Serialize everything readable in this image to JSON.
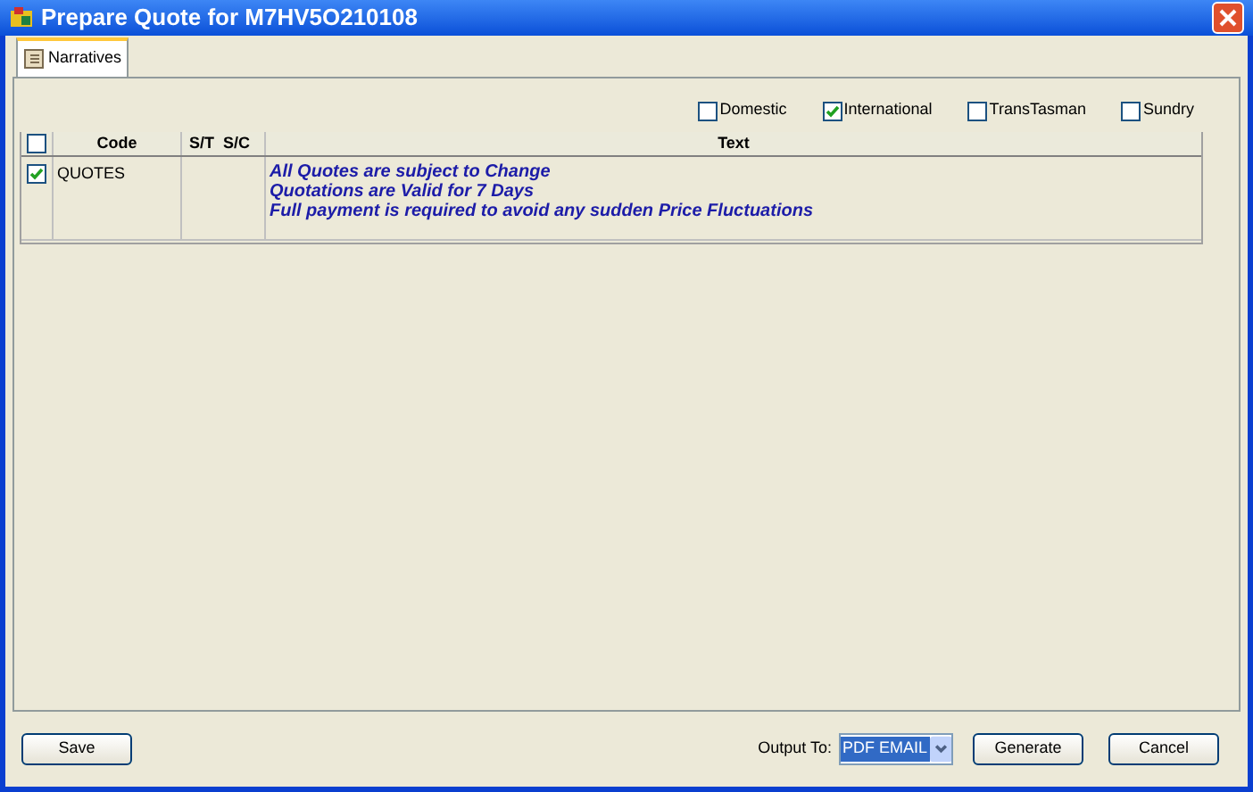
{
  "window": {
    "title": "Prepare Quote for M7HV5O210108"
  },
  "tabs": [
    {
      "label": "Narratives",
      "selected": true
    }
  ],
  "filters": [
    {
      "label": "Domestic",
      "checked": false
    },
    {
      "label": "International",
      "checked": true
    },
    {
      "label": "TransTasman",
      "checked": false
    },
    {
      "label": "Sundry",
      "checked": false
    }
  ],
  "table": {
    "select_all_checked": false,
    "columns": [
      "Code",
      "S/T",
      "S/C",
      "Text"
    ],
    "rows": [
      {
        "checked": true,
        "code": "QUOTES",
        "lines": [
          "All Quotes are subject to Change",
          "Quotations are Valid for 7 Days",
          "Full payment is required to avoid any sudden Price Fluctuations"
        ]
      }
    ]
  },
  "footer": {
    "save": "Save",
    "output_label": "Output To:",
    "output_value": "PDF EMAIL",
    "generate": "Generate",
    "cancel": "Cancel"
  }
}
